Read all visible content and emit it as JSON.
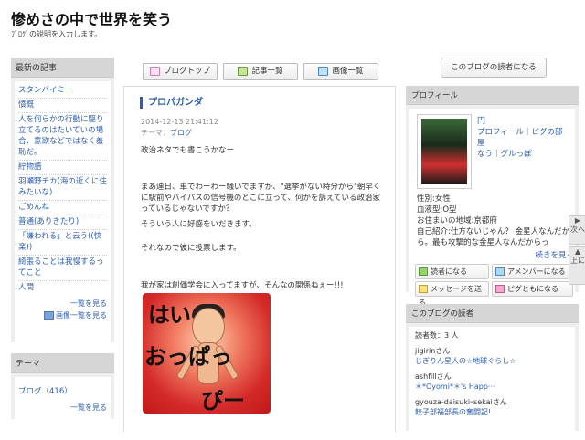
{
  "blog": {
    "title": "惨めさの中で世界を笑う",
    "description": "ﾌﾞﾛｸﾞの説明を入力します。"
  },
  "nav": {
    "top": "ブログトップ",
    "list": "記事一覧",
    "images": "画像一覧",
    "reader_button": "このブログの読者になる"
  },
  "latest": {
    "header": "最新の記事",
    "items": [
      "スタンバイミー",
      "憤慨",
      "人を何らかの行動に駆り立てるのはたいていの場合、意欲などではなく羞恥だ。",
      "紵物語",
      "羽瀬野チカ(海の近くに住みたいな)",
      "ごめんね",
      "普通(ありきたり)",
      "「嫌われる」と云う((快楽))",
      "綺張ることは我慢するってこと",
      "人間"
    ],
    "more": "一覧を見る",
    "images_more": "画像一覧を見る"
  },
  "theme": {
    "header": "テーマ",
    "item": "ブログ（416）",
    "more": "一覧を見る"
  },
  "entry": {
    "title": "プロパガンダ",
    "datetime": "2014-12-13 21:41:12",
    "theme_label": "テーマ：",
    "theme_link": "ブログ",
    "p1": "政治ネタでも書こうかなー",
    "p2": "まあ連日、車でわーわー騒いでますが、\"選挙がない時分から\"朝早くに駅前やバイパスの信号機のとこに立って、何かを訴えている政治家っているじゃないですか？",
    "p3": "そういう人に好感をいだきます。",
    "p4": "それなので彼に投票します。",
    "p5": "我が家は創価学会に入ってますが、そんなの関係ねぇー!!!",
    "sticker": [
      "はい",
      "おっぱっ",
      "ぴー"
    ]
  },
  "profile": {
    "header": "プロフィール",
    "name": "円",
    "links": "プロフィール｜ピグの部屋",
    "links2": "なう｜グルっぽ",
    "sex": "性別:女性",
    "blood": "血液型:O型",
    "location": "お住まいの地域:京都府",
    "intro": "自己紹介:仕方ないじゃん？ 金星人なんだから。最も攻撃的な金星人なんだからっ",
    "more": "続きを見る",
    "btn_reader": "読者になる",
    "btn_member": "アメンバーになる",
    "btn_message": "メッセージを送る",
    "btn_pigg": "ピグともになる"
  },
  "readers": {
    "header": "このブログの読者",
    "count": "読者数：3 人",
    "list": [
      {
        "name": "jigirinさん",
        "blog": "じぎりん星人の☆地球ぐらし☆"
      },
      {
        "name": "ashfillさん",
        "blog": "＊*Oyomi*＊'s Happ···"
      },
      {
        "name": "gyouza-daisukiｰsekaiさん",
        "blog": "餃子部福部長の奮闘記!"
      }
    ]
  },
  "side_tab": {
    "prev": "次へ",
    "up": "上に"
  }
}
